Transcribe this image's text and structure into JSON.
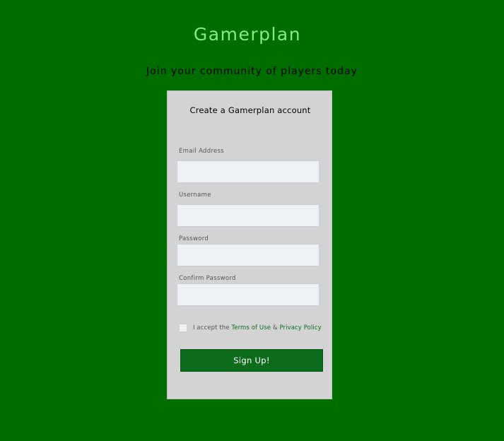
{
  "header": {
    "title": "Gamerplan",
    "tagline": "Join your community of players today"
  },
  "form": {
    "title": "Create a Gamerplan account",
    "fields": [
      {
        "label": "Email Address",
        "value": "",
        "placeholder": ""
      },
      {
        "label": "Username",
        "value": "",
        "placeholder": ""
      },
      {
        "label": "Password",
        "value": "",
        "placeholder": ""
      },
      {
        "label": "Confirm Password",
        "value": "",
        "placeholder": ""
      }
    ],
    "terms": {
      "prefix": "I accept the ",
      "terms_link": "Terms of Use",
      "joiner": " & ",
      "privacy_link": "Privacy Policy",
      "checked": false
    },
    "submit_label": "Sign Up!"
  },
  "colors": {
    "background": "#006d00",
    "brand": "#7ef07e",
    "card": "#d3d3d3",
    "input": "#edf1f6",
    "button": "#0d6b1d",
    "link": "#0a6b1e"
  }
}
